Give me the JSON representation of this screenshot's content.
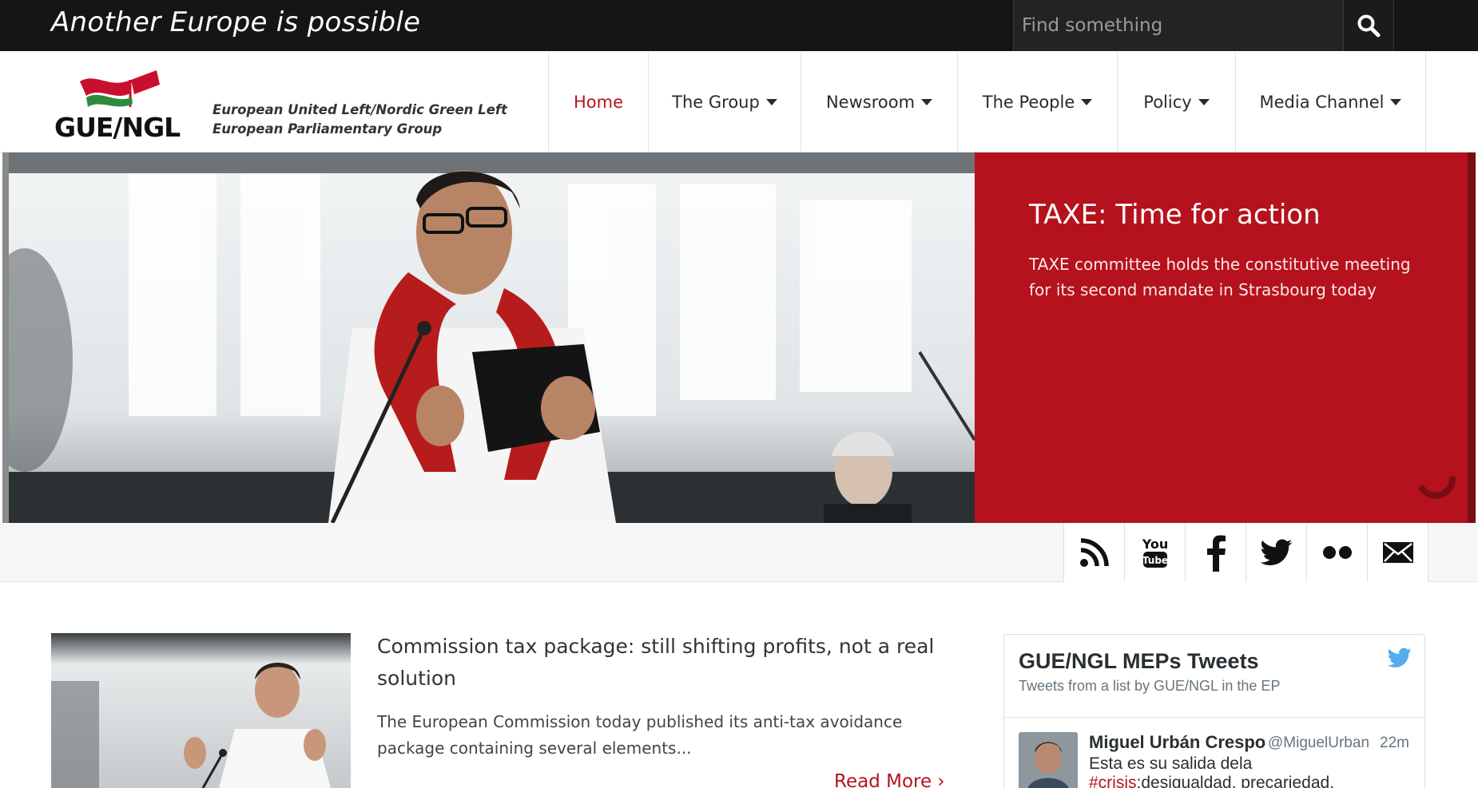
{
  "topbar": {
    "tagline": "Another Europe is possible",
    "search_placeholder": "Find something",
    "search_icon": "search-icon"
  },
  "header": {
    "logo_text": "GUE/NGL",
    "org_line1": "European United Left/Nordic Green Left",
    "org_line2": "European Parliamentary Group"
  },
  "nav": {
    "items": [
      {
        "label": "Home",
        "active": true,
        "dropdown": false
      },
      {
        "label": "The Group",
        "active": false,
        "dropdown": true
      },
      {
        "label": "Newsroom",
        "active": false,
        "dropdown": true
      },
      {
        "label": "The People",
        "active": false,
        "dropdown": true
      },
      {
        "label": "Policy",
        "active": false,
        "dropdown": true
      },
      {
        "label": "Media Channel",
        "active": false,
        "dropdown": true
      }
    ]
  },
  "hero": {
    "title": "TAXE: Time for action",
    "description": "TAXE committee holds the constitutive meeting for its second mandate in Strasbourg today"
  },
  "social": {
    "icons": [
      "rss-icon",
      "youtube-icon",
      "facebook-icon",
      "twitter-icon",
      "flickr-icon",
      "email-icon"
    ],
    "youtube_top": "You",
    "youtube_bottom": "Tube"
  },
  "article": {
    "title": "Commission tax package: still shifting profits, not a real solution",
    "excerpt": "The European Commission today published its anti-tax avoidance package containing several elements...",
    "read_more": "Read More ›"
  },
  "tweets": {
    "title": "GUE/NGL MEPs Tweets",
    "subtitle": "Tweets from a list by GUE/NGL in the EP",
    "tweet": {
      "name": "Miguel Urbán Crespo",
      "handle": "@MiguelUrban",
      "time": "22m",
      "text_line1": "Esta es su salida dela",
      "hashtag": "#crisis",
      "text_line2_rest": ":desigualdad, precariedad,"
    }
  },
  "colors": {
    "brand_red": "#b5141e",
    "topbar_bg": "#151515",
    "twitter_blue": "#55acee"
  }
}
